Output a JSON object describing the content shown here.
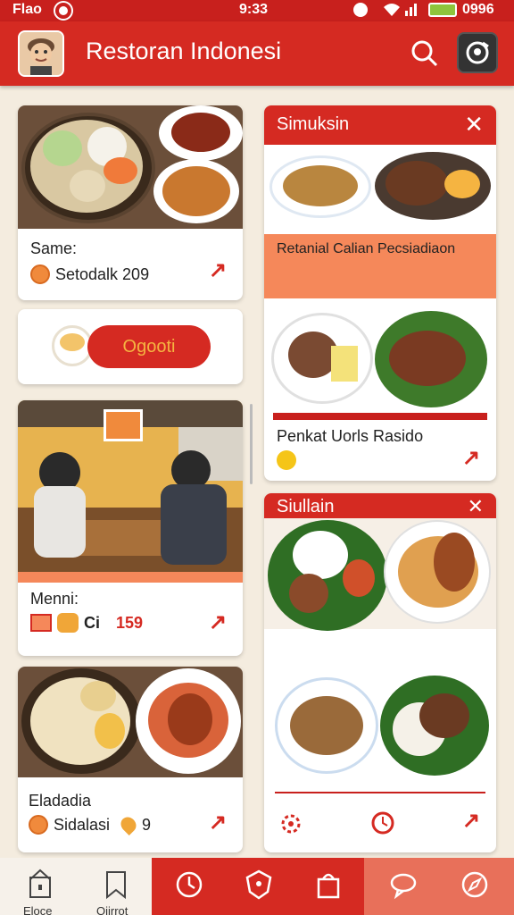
{
  "status_bar": {
    "left": "Flao",
    "time": "9:33",
    "battery": "0996"
  },
  "app_bar": {
    "title": "Restoran Indonesi"
  },
  "card_1": {
    "title": "Same:",
    "detail": "Setodalk 209"
  },
  "card_2": {
    "button": "Ogooti"
  },
  "card_3": {
    "title": "Menni:",
    "detail_a": "Ci",
    "detail_b": "159"
  },
  "card_4": {
    "title": "Eladadia",
    "detail": "Sidalasi",
    "count": "9"
  },
  "panel_1": {
    "title": "Simuksin",
    "subtitle": "Retanial Calian Pecsiadiaon",
    "caption": "Penkat Uorls   Rasido"
  },
  "panel_2": {
    "title": "Siullain"
  },
  "bottom_nav": {
    "items": [
      {
        "label": "Eloce"
      },
      {
        "label": "Oiirrot"
      }
    ]
  },
  "colors": {
    "primary": "#d52a22",
    "accent": "#f5885a",
    "background": "#f4ecdf"
  }
}
